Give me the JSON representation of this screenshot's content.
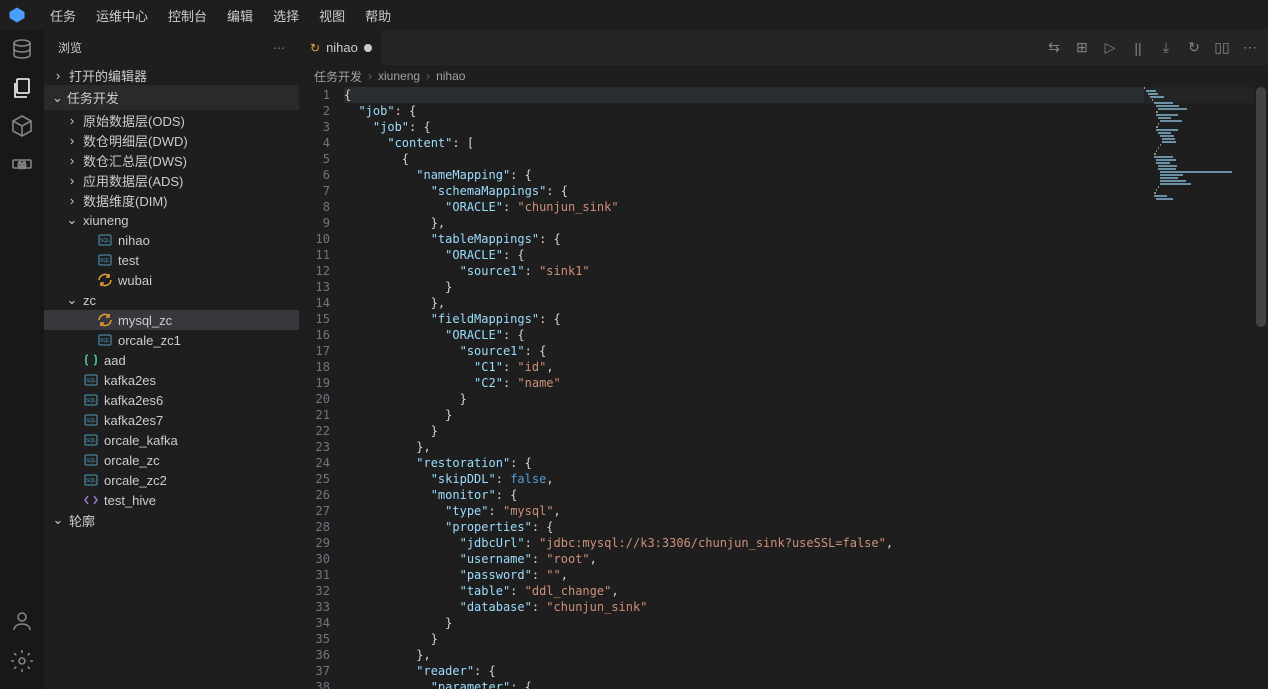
{
  "menubar": [
    "任务",
    "运维中心",
    "控制台",
    "编辑",
    "选择",
    "视图",
    "帮助"
  ],
  "sidebar": {
    "title": "浏览",
    "sections": {
      "openEditors": "打开的编辑器",
      "taskDev": "任务开发",
      "outline": "轮廓"
    },
    "tree": [
      {
        "indent": 1,
        "chev": ">",
        "label": "原始数据层(ODS)"
      },
      {
        "indent": 1,
        "chev": ">",
        "label": "数仓明细层(DWD)"
      },
      {
        "indent": 1,
        "chev": ">",
        "label": "数仓汇总层(DWS)"
      },
      {
        "indent": 1,
        "chev": ">",
        "label": "应用数据层(ADS)"
      },
      {
        "indent": 1,
        "chev": ">",
        "label": "数据维度(DIM)"
      },
      {
        "indent": 1,
        "chev": "v",
        "label": "xiuneng"
      },
      {
        "indent": 2,
        "icon": "sql",
        "color": "",
        "label": "nihao"
      },
      {
        "indent": 2,
        "icon": "sql",
        "color": "",
        "label": "test"
      },
      {
        "indent": 2,
        "icon": "sync",
        "color": "orange",
        "label": "wubai"
      },
      {
        "indent": 1,
        "chev": "v",
        "label": "zc"
      },
      {
        "indent": 2,
        "icon": "sync",
        "color": "orange",
        "label": "mysql_zc",
        "selected": true
      },
      {
        "indent": 2,
        "icon": "sql",
        "color": "",
        "label": "orcale_zc1"
      },
      {
        "indent": 1,
        "icon": "brackets",
        "color": "teal",
        "label": "aad"
      },
      {
        "indent": 1,
        "icon": "sql",
        "color": "",
        "label": "kafka2es"
      },
      {
        "indent": 1,
        "icon": "sql",
        "color": "",
        "label": "kafka2es6"
      },
      {
        "indent": 1,
        "icon": "sql",
        "color": "",
        "label": "kafka2es7"
      },
      {
        "indent": 1,
        "icon": "sql",
        "color": "",
        "label": "orcale_kafka"
      },
      {
        "indent": 1,
        "icon": "sql",
        "color": "",
        "label": "orcale_zc"
      },
      {
        "indent": 1,
        "icon": "sql",
        "color": "",
        "label": "orcale_zc2"
      },
      {
        "indent": 1,
        "icon": "code",
        "color": "purple",
        "label": "test_hive"
      }
    ]
  },
  "tab": {
    "label": "nihao"
  },
  "breadcrumbs": [
    "任务开发",
    "xiuneng",
    "nihao"
  ],
  "code": [
    {
      "n": 1,
      "hl": true,
      "i": 0,
      "t": [
        [
          "punc",
          "{"
        ]
      ]
    },
    {
      "n": 2,
      "i": 1,
      "t": [
        [
          "key",
          "\"job\""
        ],
        [
          "punc",
          ": {"
        ]
      ]
    },
    {
      "n": 3,
      "i": 2,
      "t": [
        [
          "key",
          "\"job\""
        ],
        [
          "punc",
          ": {"
        ]
      ]
    },
    {
      "n": 4,
      "i": 3,
      "t": [
        [
          "key",
          "\"content\""
        ],
        [
          "punc",
          ": ["
        ]
      ]
    },
    {
      "n": 5,
      "i": 4,
      "t": [
        [
          "punc",
          "{"
        ]
      ]
    },
    {
      "n": 6,
      "i": 5,
      "t": [
        [
          "key",
          "\"nameMapping\""
        ],
        [
          "punc",
          ": {"
        ]
      ]
    },
    {
      "n": 7,
      "i": 6,
      "t": [
        [
          "key",
          "\"schemaMappings\""
        ],
        [
          "punc",
          ": {"
        ]
      ]
    },
    {
      "n": 8,
      "i": 7,
      "t": [
        [
          "key",
          "\"ORACLE\""
        ],
        [
          "punc",
          ": "
        ],
        [
          "str",
          "\"chunjun_sink\""
        ]
      ]
    },
    {
      "n": 9,
      "i": 6,
      "t": [
        [
          "punc",
          "},"
        ]
      ]
    },
    {
      "n": 10,
      "i": 6,
      "t": [
        [
          "key",
          "\"tableMappings\""
        ],
        [
          "punc",
          ": {"
        ]
      ]
    },
    {
      "n": 11,
      "i": 7,
      "t": [
        [
          "key",
          "\"ORACLE\""
        ],
        [
          "punc",
          ": {"
        ]
      ]
    },
    {
      "n": 12,
      "i": 8,
      "t": [
        [
          "key",
          "\"source1\""
        ],
        [
          "punc",
          ": "
        ],
        [
          "str",
          "\"sink1\""
        ]
      ]
    },
    {
      "n": 13,
      "i": 7,
      "t": [
        [
          "punc",
          "}"
        ]
      ]
    },
    {
      "n": 14,
      "i": 6,
      "t": [
        [
          "punc",
          "},"
        ]
      ]
    },
    {
      "n": 15,
      "i": 6,
      "t": [
        [
          "key",
          "\"fieldMappings\""
        ],
        [
          "punc",
          ": {"
        ]
      ]
    },
    {
      "n": 16,
      "i": 7,
      "t": [
        [
          "key",
          "\"ORACLE\""
        ],
        [
          "punc",
          ": {"
        ]
      ]
    },
    {
      "n": 17,
      "i": 8,
      "t": [
        [
          "key",
          "\"source1\""
        ],
        [
          "punc",
          ": {"
        ]
      ]
    },
    {
      "n": 18,
      "i": 9,
      "t": [
        [
          "key",
          "\"C1\""
        ],
        [
          "punc",
          ": "
        ],
        [
          "str",
          "\"id\""
        ],
        [
          "punc",
          ","
        ]
      ]
    },
    {
      "n": 19,
      "i": 9,
      "t": [
        [
          "key",
          "\"C2\""
        ],
        [
          "punc",
          ": "
        ],
        [
          "str",
          "\"name\""
        ]
      ]
    },
    {
      "n": 20,
      "i": 8,
      "t": [
        [
          "punc",
          "}"
        ]
      ]
    },
    {
      "n": 21,
      "i": 7,
      "t": [
        [
          "punc",
          "}"
        ]
      ]
    },
    {
      "n": 22,
      "i": 6,
      "t": [
        [
          "punc",
          "}"
        ]
      ]
    },
    {
      "n": 23,
      "i": 5,
      "t": [
        [
          "punc",
          "},"
        ]
      ]
    },
    {
      "n": 24,
      "i": 5,
      "t": [
        [
          "key",
          "\"restoration\""
        ],
        [
          "punc",
          ": {"
        ]
      ]
    },
    {
      "n": 25,
      "i": 6,
      "t": [
        [
          "key",
          "\"skipDDL\""
        ],
        [
          "punc",
          ": "
        ],
        [
          "bool",
          "false"
        ],
        [
          "punc",
          ","
        ]
      ]
    },
    {
      "n": 26,
      "i": 6,
      "t": [
        [
          "key",
          "\"monitor\""
        ],
        [
          "punc",
          ": {"
        ]
      ]
    },
    {
      "n": 27,
      "i": 7,
      "t": [
        [
          "key",
          "\"type\""
        ],
        [
          "punc",
          ": "
        ],
        [
          "str",
          "\"mysql\""
        ],
        [
          "punc",
          ","
        ]
      ]
    },
    {
      "n": 28,
      "i": 7,
      "t": [
        [
          "key",
          "\"properties\""
        ],
        [
          "punc",
          ": {"
        ]
      ]
    },
    {
      "n": 29,
      "i": 8,
      "t": [
        [
          "key",
          "\"jdbcUrl\""
        ],
        [
          "punc",
          ": "
        ],
        [
          "str",
          "\"jdbc:mysql://k3:3306/chunjun_sink?useSSL=false\""
        ],
        [
          "punc",
          ","
        ]
      ]
    },
    {
      "n": 30,
      "i": 8,
      "t": [
        [
          "key",
          "\"username\""
        ],
        [
          "punc",
          ": "
        ],
        [
          "str",
          "\"root\""
        ],
        [
          "punc",
          ","
        ]
      ]
    },
    {
      "n": 31,
      "i": 8,
      "t": [
        [
          "key",
          "\"password\""
        ],
        [
          "punc",
          ": "
        ],
        [
          "str",
          "\"\""
        ],
        [
          "punc",
          ","
        ]
      ]
    },
    {
      "n": 32,
      "i": 8,
      "t": [
        [
          "key",
          "\"table\""
        ],
        [
          "punc",
          ": "
        ],
        [
          "str",
          "\"ddl_change\""
        ],
        [
          "punc",
          ","
        ]
      ]
    },
    {
      "n": 33,
      "i": 8,
      "t": [
        [
          "key",
          "\"database\""
        ],
        [
          "punc",
          ": "
        ],
        [
          "str",
          "\"chunjun_sink\""
        ]
      ]
    },
    {
      "n": 34,
      "i": 7,
      "t": [
        [
          "punc",
          "}"
        ]
      ]
    },
    {
      "n": 35,
      "i": 6,
      "t": [
        [
          "punc",
          "}"
        ]
      ]
    },
    {
      "n": 36,
      "i": 5,
      "t": [
        [
          "punc",
          "},"
        ]
      ]
    },
    {
      "n": 37,
      "i": 5,
      "t": [
        [
          "key",
          "\"reader\""
        ],
        [
          "punc",
          ": {"
        ]
      ]
    },
    {
      "n": 38,
      "i": 6,
      "t": [
        [
          "key",
          "\"parameter\""
        ],
        [
          "punc",
          ": {"
        ]
      ]
    }
  ]
}
